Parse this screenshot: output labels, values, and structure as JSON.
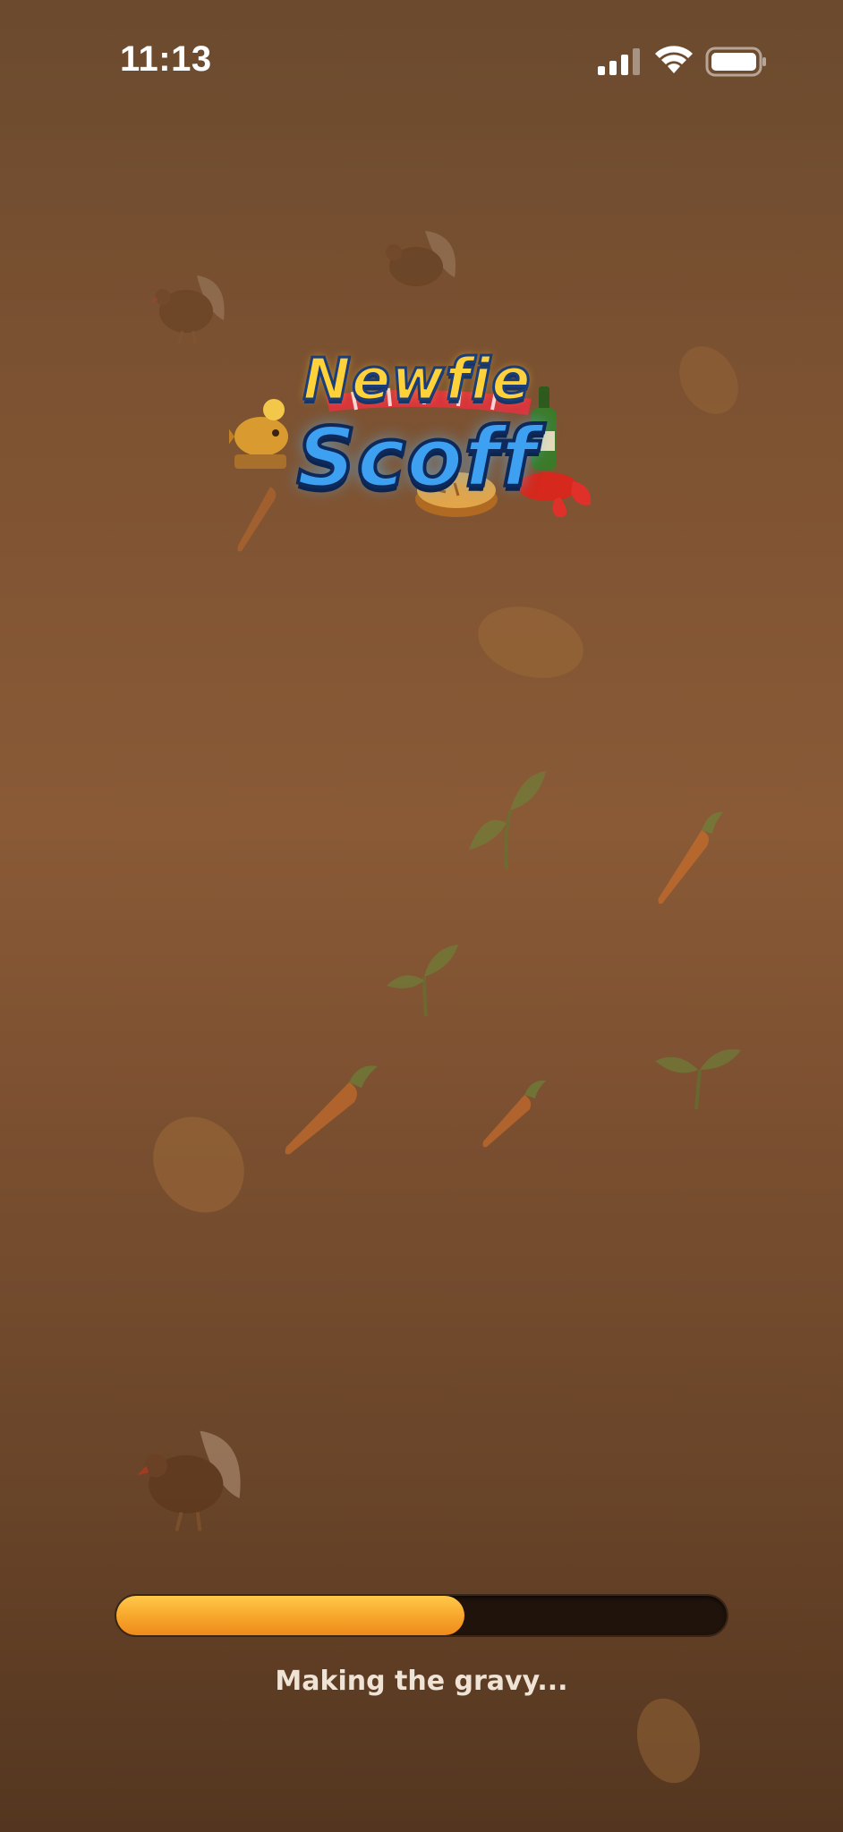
{
  "status_bar": {
    "time": "11:13",
    "icons": [
      "signal-icon",
      "wifi-icon",
      "battery-icon"
    ]
  },
  "logo": {
    "line1": "Newfie",
    "line2": "Scoff"
  },
  "loading": {
    "progress": 0.57,
    "message": "Making the gravy..."
  },
  "colors": {
    "background": "#7a5131",
    "progress_fill": "#f7a52a",
    "progress_track": "#1f130b",
    "logo_yellow": "#ffd23a",
    "logo_blue": "#3ea0f0"
  },
  "decorations": [
    "turkey-icon",
    "potato-icon",
    "carrot-icon",
    "sprout-icon",
    "fish-icon",
    "pie-icon",
    "lobster-icon",
    "bottle-icon"
  ]
}
